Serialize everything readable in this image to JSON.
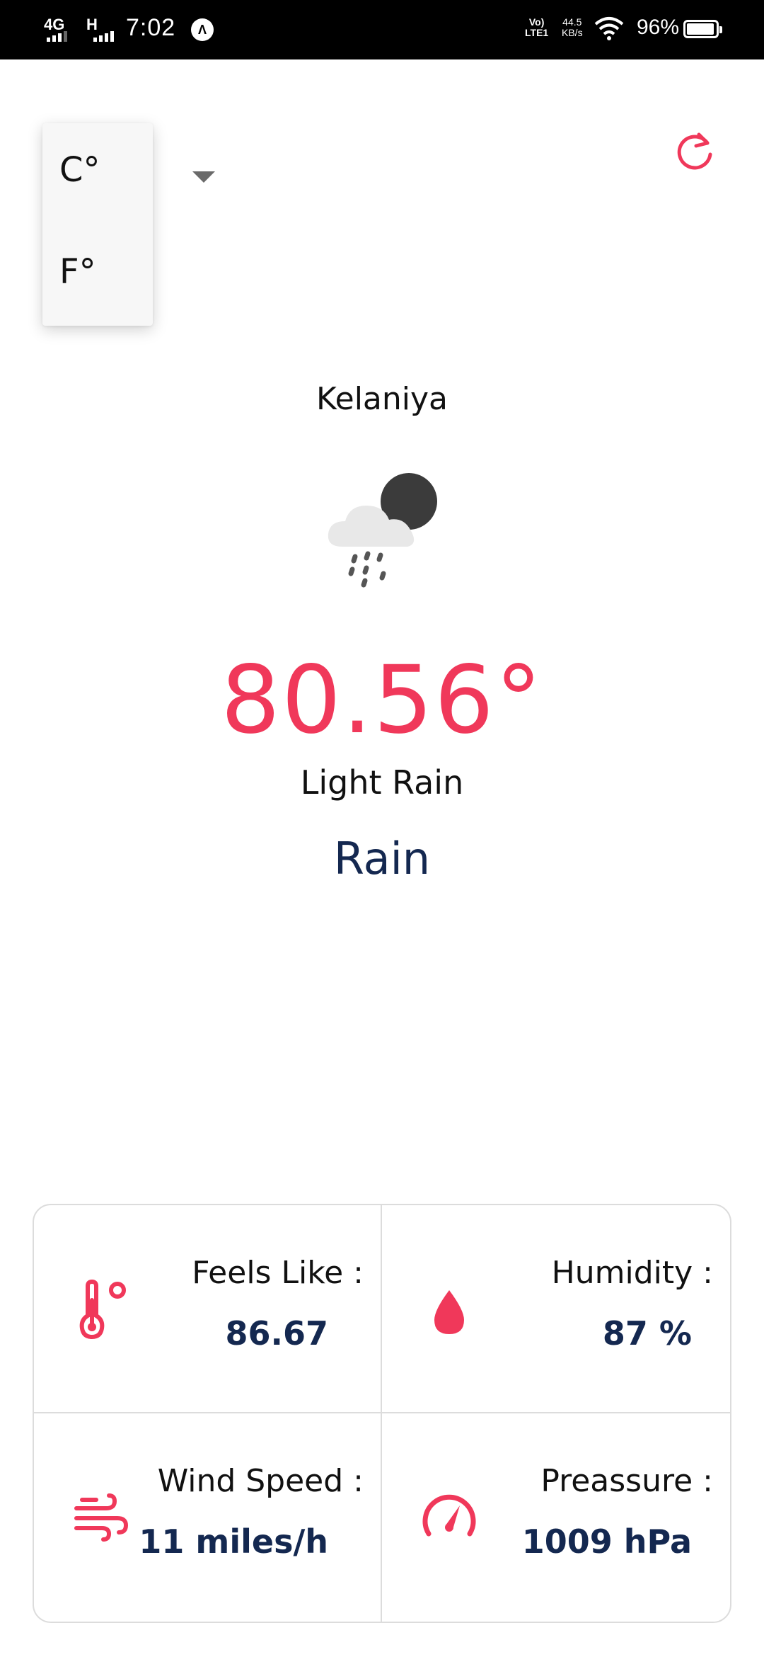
{
  "status_bar": {
    "network1": "4G",
    "network2": "H",
    "time": "7:02",
    "nav_icon": "Λ",
    "volte_line1": "Vo)",
    "volte_line2": "LTE1",
    "speed_line1": "44.5",
    "speed_line2": "KB/s",
    "battery_text": "96%",
    "battery_level": 0.96
  },
  "unit_menu": {
    "options": [
      "C°",
      "F°"
    ]
  },
  "weather": {
    "city": "Kelaniya",
    "temperature": "80.56°",
    "description": "Light Rain",
    "condition": "Rain"
  },
  "stats": {
    "feels_like": {
      "label": "Feels Like :",
      "value": "86.67"
    },
    "humidity": {
      "label": "Humidity :",
      "value": "87 %"
    },
    "wind_speed": {
      "label": "Wind Speed :",
      "value": "11 miles/h"
    },
    "pressure": {
      "label": "Preassure :",
      "value": "1009 hPa"
    }
  },
  "colors": {
    "accent": "#f0385a",
    "navy": "#142850",
    "border": "#dcdcdc"
  },
  "icons": {
    "thermometer": "thermometer-icon",
    "humidity": "water-drop-icon",
    "wind": "wind-icon",
    "pressure": "gauge-icon",
    "refresh": "refresh-icon",
    "weather": "rain-night-icon"
  }
}
